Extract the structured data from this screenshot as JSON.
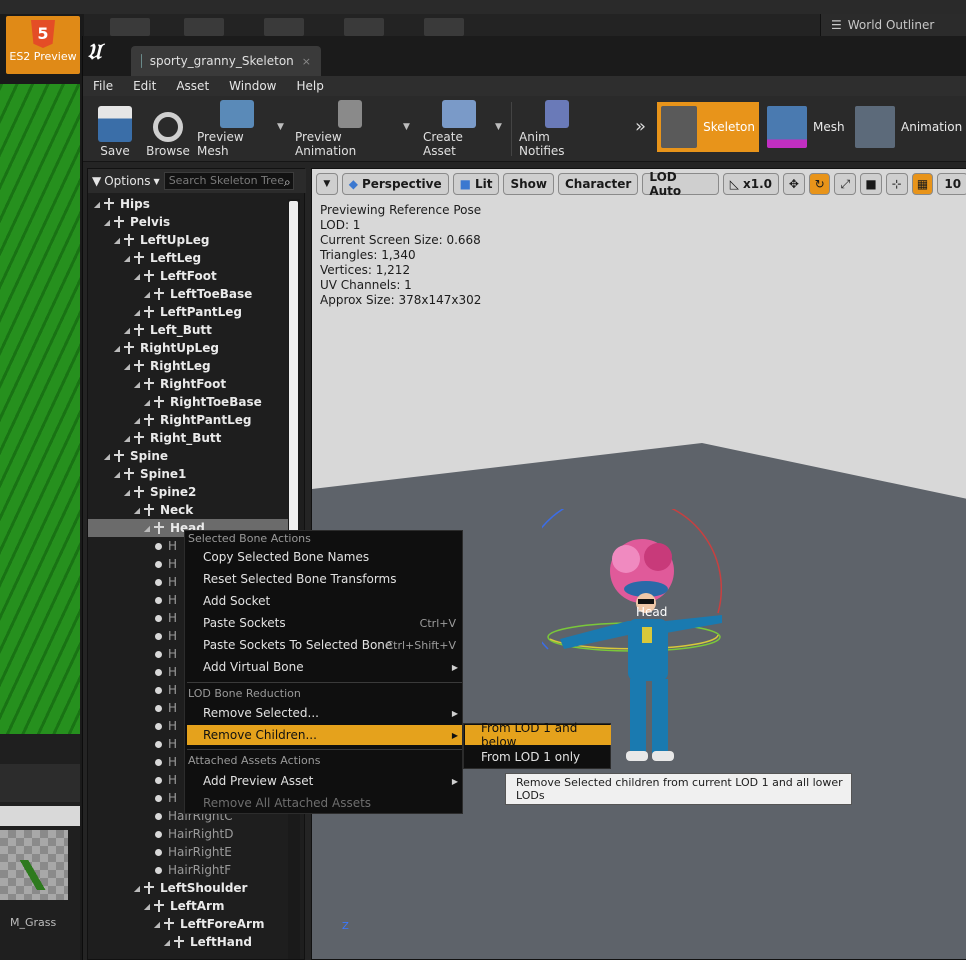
{
  "background": {
    "es2_label": "ES2 Preview",
    "es2_badge": "5",
    "world_outliner": "World Outliner",
    "material_label": "M_Grass"
  },
  "window": {
    "tab_title": "sporty_granny_Skeleton",
    "tab_close": "×"
  },
  "menubar": [
    "File",
    "Edit",
    "Asset",
    "Window",
    "Help"
  ],
  "toolbar": {
    "save": "Save",
    "browse": "Browse",
    "preview_mesh": "Preview Mesh",
    "preview_animation": "Preview Animation",
    "create_asset": "Create Asset",
    "anim_notifies": "Anim Notifies"
  },
  "modes": {
    "skeleton": "Skeleton",
    "mesh": "Mesh",
    "animation": "Animation"
  },
  "tree": {
    "options": "Options",
    "search_placeholder": "Search Skeleton Tree",
    "bones": [
      {
        "name": "Hips",
        "depth": 0,
        "bold": true
      },
      {
        "name": "Pelvis",
        "depth": 1,
        "bold": true
      },
      {
        "name": "LeftUpLeg",
        "depth": 2,
        "bold": true
      },
      {
        "name": "LeftLeg",
        "depth": 3,
        "bold": true
      },
      {
        "name": "LeftFoot",
        "depth": 4,
        "bold": true
      },
      {
        "name": "LeftToeBase",
        "depth": 5,
        "bold": true
      },
      {
        "name": "LeftPantLeg",
        "depth": 4,
        "bold": true
      },
      {
        "name": "Left_Butt",
        "depth": 3,
        "bold": true
      },
      {
        "name": "RightUpLeg",
        "depth": 2,
        "bold": true
      },
      {
        "name": "RightLeg",
        "depth": 3,
        "bold": true
      },
      {
        "name": "RightFoot",
        "depth": 4,
        "bold": true
      },
      {
        "name": "RightToeBase",
        "depth": 5,
        "bold": true
      },
      {
        "name": "RightPantLeg",
        "depth": 4,
        "bold": true
      },
      {
        "name": "Right_Butt",
        "depth": 3,
        "bold": true
      },
      {
        "name": "Spine",
        "depth": 1,
        "bold": true
      },
      {
        "name": "Spine1",
        "depth": 2,
        "bold": true
      },
      {
        "name": "Spine2",
        "depth": 3,
        "bold": true
      },
      {
        "name": "Neck",
        "depth": 4,
        "bold": true
      },
      {
        "name": "Head",
        "depth": 5,
        "bold": true,
        "selected": true
      },
      {
        "name": "H",
        "depth": 6,
        "bold": false
      },
      {
        "name": "H",
        "depth": 6,
        "bold": false
      },
      {
        "name": "H",
        "depth": 6,
        "bold": false
      },
      {
        "name": "H",
        "depth": 6,
        "bold": false
      },
      {
        "name": "H",
        "depth": 6,
        "bold": false
      },
      {
        "name": "H",
        "depth": 6,
        "bold": false
      },
      {
        "name": "H",
        "depth": 6,
        "bold": false
      },
      {
        "name": "H",
        "depth": 6,
        "bold": false
      },
      {
        "name": "H",
        "depth": 6,
        "bold": false
      },
      {
        "name": "H",
        "depth": 6,
        "bold": false
      },
      {
        "name": "H",
        "depth": 6,
        "bold": false
      },
      {
        "name": "H",
        "depth": 6,
        "bold": false
      },
      {
        "name": "H",
        "depth": 6,
        "bold": false
      },
      {
        "name": "H",
        "depth": 6,
        "bold": false
      },
      {
        "name": "H",
        "depth": 6,
        "bold": false
      },
      {
        "name": "HairRightC",
        "depth": 6,
        "bold": false
      },
      {
        "name": "HairRightD",
        "depth": 6,
        "bold": false
      },
      {
        "name": "HairRightE",
        "depth": 6,
        "bold": false
      },
      {
        "name": "HairRightF",
        "depth": 6,
        "bold": false
      },
      {
        "name": "LeftShoulder",
        "depth": 4,
        "bold": true
      },
      {
        "name": "LeftArm",
        "depth": 5,
        "bold": true
      },
      {
        "name": "LeftForeArm",
        "depth": 6,
        "bold": true
      },
      {
        "name": "LeftHand",
        "depth": 7,
        "bold": true
      }
    ]
  },
  "viewport": {
    "perspective": "Perspective",
    "lit": "Lit",
    "show": "Show",
    "character": "Character",
    "lod": "LOD Auto",
    "speed": "x1.0",
    "grid_value": "10",
    "info": [
      "Previewing Reference Pose",
      "LOD: 1",
      "Current Screen Size: 0.668",
      "Triangles: 1,340",
      "Vertices: 1,212",
      "UV Channels: 1",
      "Approx Size: 378x147x302"
    ],
    "head_label": "Head",
    "axis_z": "Z"
  },
  "context_menu": {
    "section1": "Selected Bone Actions",
    "copy_names": "Copy Selected Bone Names",
    "reset_transforms": "Reset Selected Bone Transforms",
    "add_socket": "Add Socket",
    "paste_sockets": "Paste Sockets",
    "paste_sockets_shortcut": "Ctrl+V",
    "paste_to_bone": "Paste Sockets To Selected Bone",
    "paste_to_bone_shortcut": "Ctrl+Shift+V",
    "add_virtual_bone": "Add Virtual Bone",
    "section2": "LOD Bone Reduction",
    "remove_selected": "Remove Selected...",
    "remove_children": "Remove Children...",
    "section3": "Attached Assets Actions",
    "add_preview_asset": "Add Preview Asset",
    "remove_all_attached": "Remove All Attached Assets"
  },
  "submenu": {
    "from_lod_below": "From LOD 1 and below",
    "from_lod_only": "From LOD 1 only"
  },
  "tooltip": "Remove Selected children from current LOD 1 and all lower LODs"
}
